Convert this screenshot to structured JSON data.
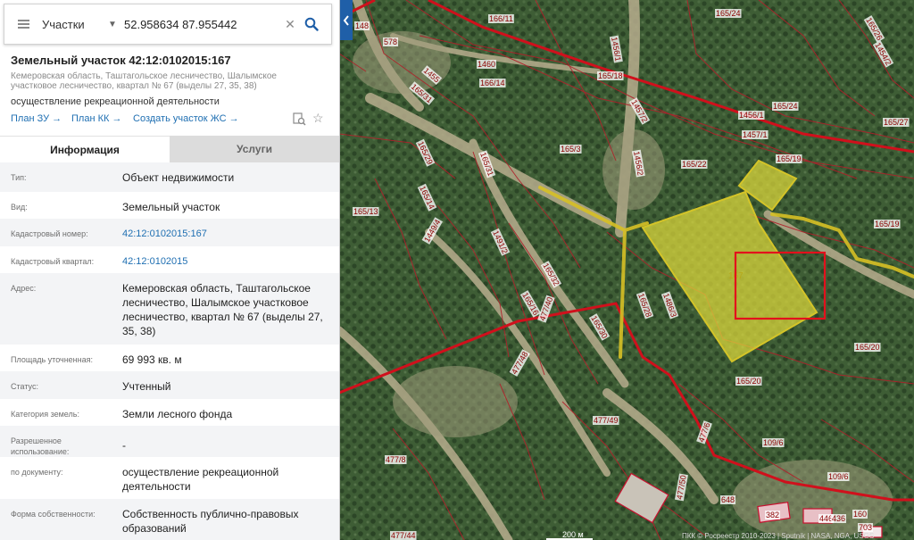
{
  "search": {
    "type_label": "Участки",
    "query": "52.958634 87.955442"
  },
  "parcel": {
    "title": "Земельный участок 42:12:0102015:167",
    "address": "Кемеровская область, Таштагольское лесничество, Шалымское участковое лесничество, квартал № 67 (выделы 27, 35, 38)",
    "usage": "осуществление рекреационной деятельности"
  },
  "links": {
    "plan_zu": "План ЗУ →",
    "plan_kk": "План КК →",
    "create": "Создать участок ЖС →"
  },
  "tabs": {
    "info": "Информация",
    "services": "Услуги"
  },
  "info": {
    "type": {
      "label": "Тип:",
      "value": "Объект недвижимости"
    },
    "kind": {
      "label": "Вид:",
      "value": "Земельный участок"
    },
    "cad_number": {
      "label": "Кадастровый номер:",
      "value": "42:12:0102015:167"
    },
    "cad_block": {
      "label": "Кадастровый квартал:",
      "value": "42:12:0102015"
    },
    "address": {
      "label": "Адрес:",
      "value": "Кемеровская область, Таштагольское лесничество, Шалымское участковое лесничество, квартал № 67 (выделы 27, 35, 38)"
    },
    "area": {
      "label": "Площадь уточненная:",
      "value": "69 993 кв. м"
    },
    "status": {
      "label": "Статус:",
      "value": "Учтенный"
    },
    "category": {
      "label": "Категория земель:",
      "value": "Земли лесного фонда"
    },
    "permitted": {
      "label": "Разрешенное использование:",
      "value": "-"
    },
    "by_document": {
      "label": "по документу:",
      "value": "осуществление рекреационной деятельности"
    },
    "ownership": {
      "label": "Форма собственности:",
      "value": "Собственность публично-правовых образований"
    }
  },
  "map": {
    "scale_label": "200 м",
    "attribution": "ПКК © Росреестр 2010-2023 | Sputnik | NASA, NGA, USGS",
    "selected_parcel_label": "167",
    "parcel_labels": [
      "148",
      "578",
      "166/11",
      "165/24",
      "165/26",
      "1454/2",
      "1455",
      "1460",
      "166/14",
      "165/18",
      "1456/1",
      "165/31",
      "1457/2",
      "165/24",
      "165/27",
      "1456/1",
      "1457/1",
      "165/3",
      "165/19",
      "165/22",
      "1456/2",
      "165/29",
      "165/31",
      "165/14",
      "165/13",
      "1491/2",
      "1449/4",
      "165/32",
      "165/19",
      "165/16",
      "165/28",
      "1486/3",
      "477/40",
      "165/30",
      "165/20",
      "165/20",
      "477/48",
      "477/49",
      "109/6",
      "477/6",
      "477/8",
      "109/6",
      "648",
      "382",
      "446",
      "477/50",
      "436",
      "160",
      "703",
      "477/44"
    ]
  },
  "colors": {
    "accent": "#1f5fa8",
    "link": "#1f6fb2",
    "boundary": "#c8102e",
    "selected_fill": "#e3dd3c",
    "road_overlay": "#d7c025"
  }
}
